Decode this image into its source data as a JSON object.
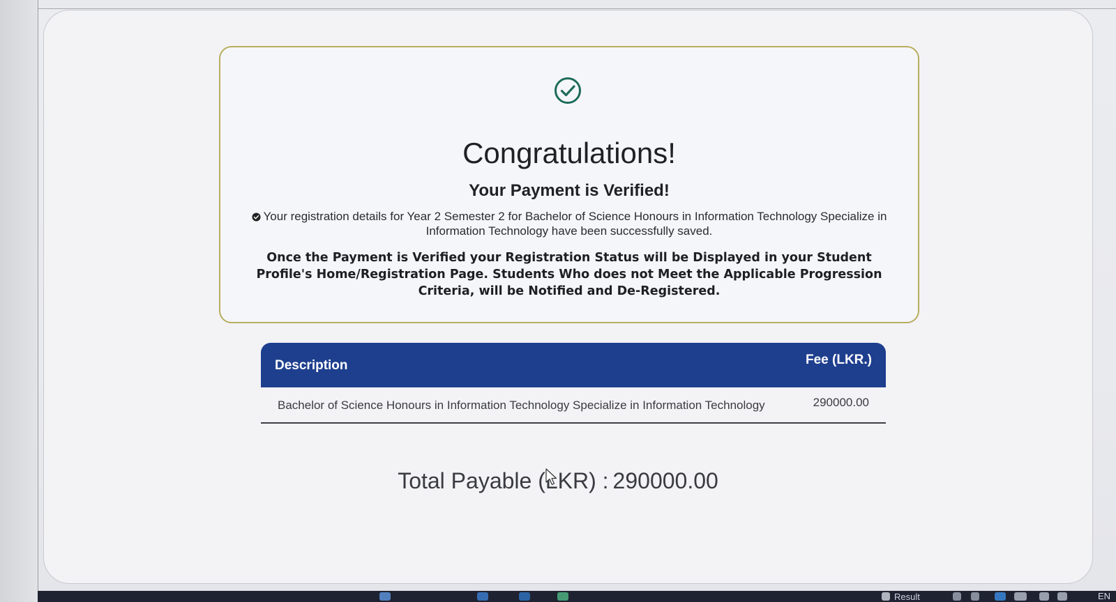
{
  "card": {
    "heading": "Congratulations!",
    "subheading": "Your Payment is Verified!",
    "saved_message": "Your registration details for Year 2 Semester 2 for Bachelor of Science Honours in Information Technology Specialize in Information Technology have been successfully saved.",
    "notice": "Once the Payment is Verified your Registration Status will be Displayed in your Student Profile's Home/Registration Page. Students Who does not Meet the Applicable Progression Criteria, will be Notified and De-Registered.",
    "accent_color": "#1d6b5a"
  },
  "fee_table": {
    "headers": {
      "description": "Description",
      "fee": "Fee (LKR.)"
    },
    "rows": [
      {
        "description": "Bachelor of Science Honours in Information Technology Specialize in Information Technology",
        "fee": "290000.00"
      }
    ],
    "header_color": "#1e3f8e"
  },
  "total": {
    "label": "Total Payable (LKR) :",
    "amount": "290000.00"
  },
  "taskbar": {
    "search_label": "Result",
    "language": "EN"
  }
}
